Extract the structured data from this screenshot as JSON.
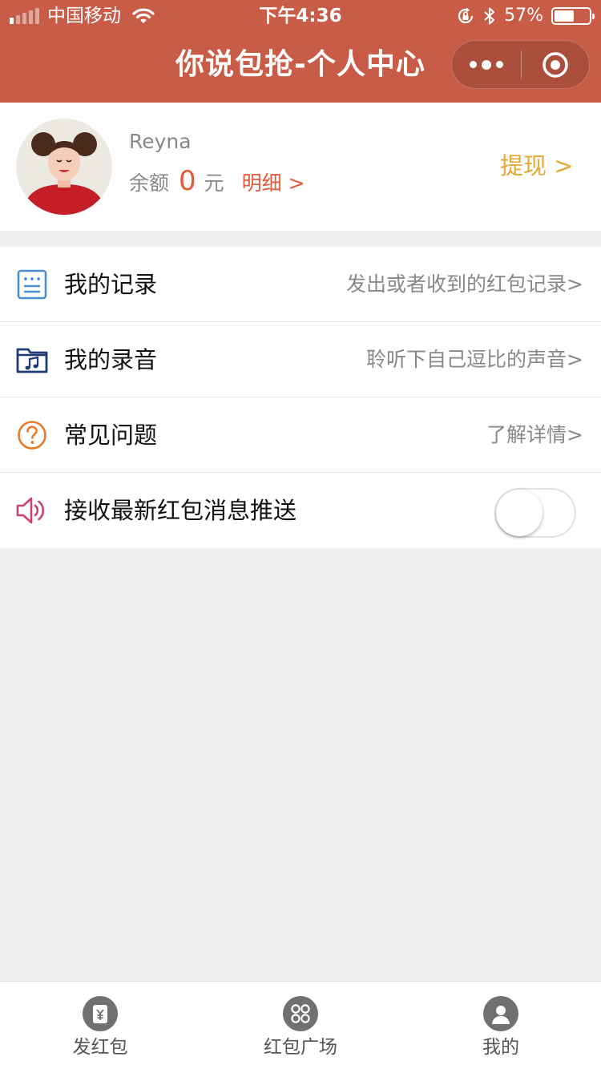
{
  "status_bar": {
    "carrier": "中国移动",
    "time": "下午4:36",
    "battery_text": "57%",
    "battery_level": 0.57,
    "signal_bars_active": 1,
    "icons": [
      "signal-icon",
      "wifi-icon",
      "rotation-lock-icon",
      "bluetooth-icon",
      "battery-icon"
    ]
  },
  "nav": {
    "title": "你说包抢-个人中心",
    "icons": [
      "more-icon",
      "close-target-icon"
    ]
  },
  "profile": {
    "username": "Reyna",
    "balance_label": "余额",
    "balance_value": "0",
    "balance_unit": "元",
    "detail_link": "明细 >",
    "withdraw_link": "提现 >"
  },
  "menu": {
    "items": [
      {
        "title": "我的记录",
        "hint": "发出或者收到的红包记录>",
        "icon": "record-list-icon",
        "icon_color": "#4a8fd0"
      },
      {
        "title": "我的录音",
        "hint": "聆听下自己逗比的声音>",
        "icon": "music-folder-icon",
        "icon_color": "#1e3a78"
      },
      {
        "title": "常见问题",
        "hint": "了解详情>",
        "icon": "question-icon",
        "icon_color": "#e87a2a"
      },
      {
        "title": "接收最新红包消息推送",
        "icon": "speaker-icon",
        "icon_color": "#d0406e",
        "toggle_on": false
      }
    ]
  },
  "tabbar": {
    "tabs": [
      {
        "label": "发红包",
        "icon": "yen-bag-icon"
      },
      {
        "label": "红包广场",
        "icon": "four-dots-icon"
      },
      {
        "label": "我的",
        "icon": "user-icon"
      }
    ]
  },
  "colors": {
    "header": "#c85c46",
    "accent_red": "#e25a3a",
    "withdraw": "#e8a832",
    "page_bg": "#efefef"
  }
}
